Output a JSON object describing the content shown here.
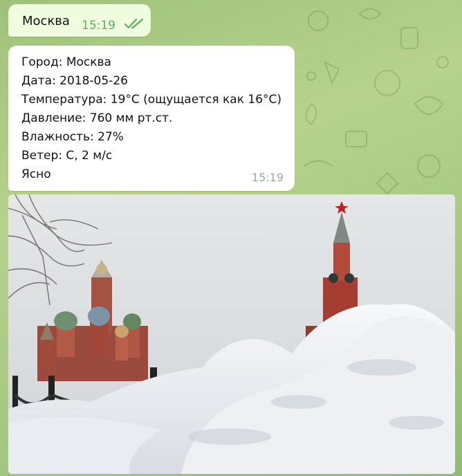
{
  "outgoing": {
    "text": "Москва",
    "time": "15:19",
    "status_icon": "double-check-icon"
  },
  "incoming": {
    "lines": [
      "Город: Москва",
      "Дата: 2018-05-26",
      "Температура: 19°C (ощущается как 16°C)",
      "Давление: 760 мм рт.ст.",
      "Влажность: 27%",
      "Ветер: С, 2 м/с",
      "Ясно"
    ],
    "time": "15:19"
  },
  "colors": {
    "outgoing_bubble": "#effdde",
    "incoming_bubble": "#ffffff",
    "wallpaper": "#a9cb83",
    "read_checks": "#5fae5a"
  }
}
